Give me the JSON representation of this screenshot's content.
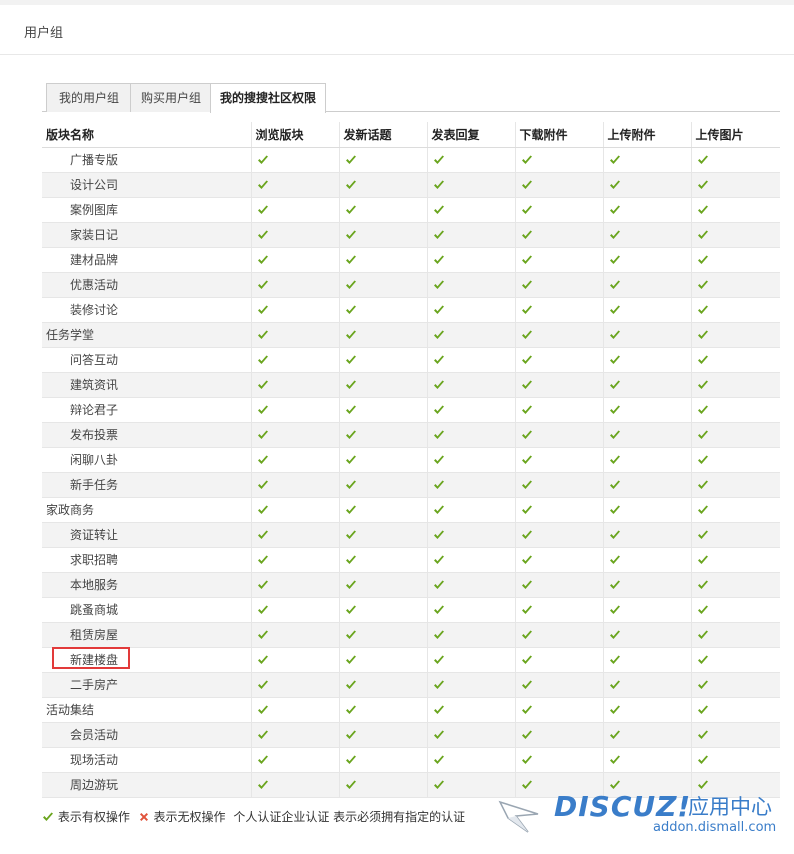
{
  "header": {
    "title": "用户组"
  },
  "tabs": [
    {
      "label": "我的用户组",
      "active": false
    },
    {
      "label": "购买用户组",
      "active": false
    },
    {
      "label": "我的搜搜社区权限",
      "active": true
    }
  ],
  "table": {
    "columns": [
      "版块名称",
      "浏览版块",
      "发新话题",
      "发表回复",
      "下载附件",
      "上传附件",
      "上传图片"
    ],
    "rows": [
      {
        "name": "广播专版",
        "level": "child",
        "perms": [
          true,
          true,
          true,
          true,
          true,
          true
        ]
      },
      {
        "name": "设计公司",
        "level": "child",
        "perms": [
          true,
          true,
          true,
          true,
          true,
          true
        ]
      },
      {
        "name": "案例图库",
        "level": "child",
        "perms": [
          true,
          true,
          true,
          true,
          true,
          true
        ]
      },
      {
        "name": "家装日记",
        "level": "child",
        "perms": [
          true,
          true,
          true,
          true,
          true,
          true
        ]
      },
      {
        "name": "建材品牌",
        "level": "child",
        "perms": [
          true,
          true,
          true,
          true,
          true,
          true
        ]
      },
      {
        "name": "优惠活动",
        "level": "child",
        "perms": [
          true,
          true,
          true,
          true,
          true,
          true
        ]
      },
      {
        "name": "装修讨论",
        "level": "child",
        "perms": [
          true,
          true,
          true,
          true,
          true,
          true
        ]
      },
      {
        "name": "任务学堂",
        "level": "parent",
        "perms": [
          true,
          true,
          true,
          true,
          true,
          true
        ]
      },
      {
        "name": "问答互动",
        "level": "child",
        "perms": [
          true,
          true,
          true,
          true,
          true,
          true
        ]
      },
      {
        "name": "建筑资讯",
        "level": "child",
        "perms": [
          true,
          true,
          true,
          true,
          true,
          true
        ]
      },
      {
        "name": "辩论君子",
        "level": "child",
        "perms": [
          true,
          true,
          true,
          true,
          true,
          true
        ]
      },
      {
        "name": "发布投票",
        "level": "child",
        "perms": [
          true,
          true,
          true,
          true,
          true,
          true
        ]
      },
      {
        "name": "闲聊八卦",
        "level": "child",
        "perms": [
          true,
          true,
          true,
          true,
          true,
          true
        ]
      },
      {
        "name": "新手任务",
        "level": "child",
        "perms": [
          true,
          true,
          true,
          true,
          true,
          true
        ]
      },
      {
        "name": "家政商务",
        "level": "parent",
        "perms": [
          true,
          true,
          true,
          true,
          true,
          true
        ]
      },
      {
        "name": "资证转让",
        "level": "child",
        "perms": [
          true,
          true,
          true,
          true,
          true,
          true
        ]
      },
      {
        "name": "求职招聘",
        "level": "child",
        "perms": [
          true,
          true,
          true,
          true,
          true,
          true
        ]
      },
      {
        "name": "本地服务",
        "level": "child",
        "perms": [
          true,
          true,
          true,
          true,
          true,
          true
        ]
      },
      {
        "name": "跳蚤商城",
        "level": "child",
        "perms": [
          true,
          true,
          true,
          true,
          true,
          true
        ]
      },
      {
        "name": "租赁房屋",
        "level": "child",
        "perms": [
          true,
          true,
          true,
          true,
          true,
          true
        ]
      },
      {
        "name": "新建楼盘",
        "level": "child",
        "perms": [
          true,
          true,
          true,
          true,
          true,
          true
        ]
      },
      {
        "name": "二手房产",
        "level": "child",
        "perms": [
          true,
          true,
          true,
          true,
          true,
          true
        ]
      },
      {
        "name": "活动集结",
        "level": "parent",
        "perms": [
          true,
          true,
          true,
          true,
          true,
          true
        ]
      },
      {
        "name": "会员活动",
        "level": "child",
        "perms": [
          true,
          true,
          true,
          true,
          true,
          true
        ]
      },
      {
        "name": "现场活动",
        "level": "child",
        "perms": [
          true,
          true,
          true,
          true,
          true,
          true
        ]
      },
      {
        "name": "周边游玩",
        "level": "child",
        "perms": [
          true,
          true,
          true,
          true,
          true,
          true
        ]
      }
    ]
  },
  "legend": {
    "has_perm": "表示有权操作",
    "no_perm": "表示无权操作",
    "note": "个人认证企业认证 表示必须拥有指定的认证"
  },
  "watermark": {
    "brand": "DISCUZ!",
    "cn": "应用中心",
    "url": "addon.dismall.com"
  },
  "colors": {
    "check": "#6aa51e",
    "cross": "#e0533b",
    "highlight": "#e23a3a",
    "watermark": "#3a7dc9"
  }
}
